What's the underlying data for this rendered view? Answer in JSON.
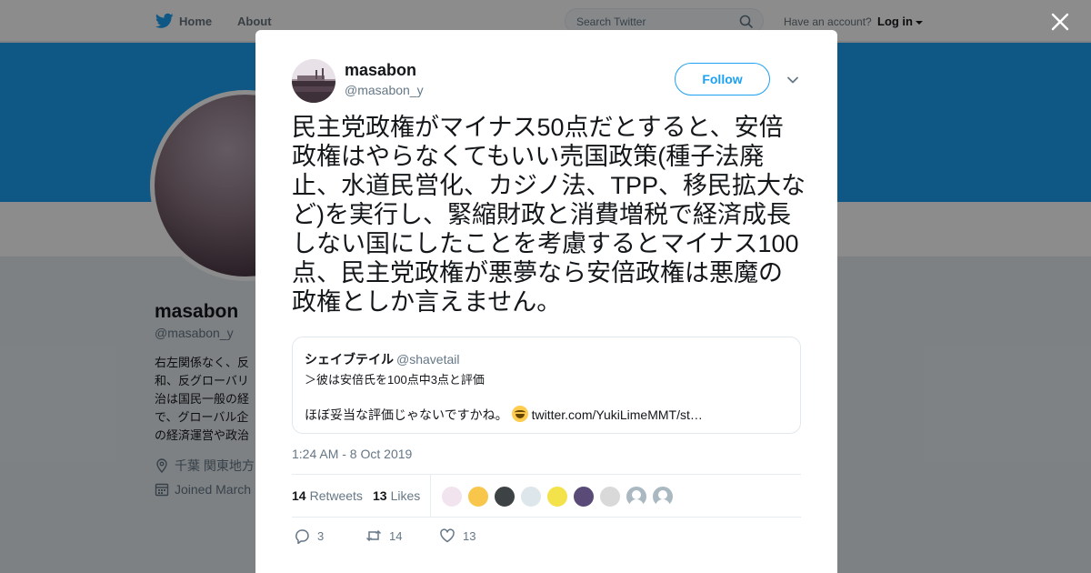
{
  "nav": {
    "home": "Home",
    "about": "About",
    "search_placeholder": "Search Twitter",
    "have_account": "Have an account?",
    "login": "Log in"
  },
  "profile": {
    "name": "masabon",
    "handle": "@masabon_y",
    "bio_lines": [
      "右左関係なく、反",
      "和、反グローバリ",
      "治は国民一般の経",
      "で、グローバル企",
      "の経済運営や政治"
    ],
    "location": "千葉 関東地方",
    "joined": "Joined March"
  },
  "tweet": {
    "author_name": "masabon",
    "author_handle": "@masabon_y",
    "follow_label": "Follow",
    "text": "民主党政権がマイナス50点だとすると、安倍政権はやらなくてもいい売国政策(種子法廃止、水道民営化、カジノ法、TPP、移民拡大など)を実行し、緊縮財政と消費増税で経済成長しない国にしたことを考慮するとマイナス100点、民主党政権が悪夢なら安倍政権は悪魔の政権としか言えません。",
    "quote": {
      "name": "シェイブテイル",
      "handle": "@shavetail",
      "line1": "＞彼は安倍氏を100点中3点と評価",
      "line2_text": "ほぼ妥当な評価じゃないですかね。",
      "line2_link": "twitter.com/YukiLimeMMT/st…"
    },
    "timestamp": "1:24 AM - 8 Oct 2019",
    "retweets_count": "14",
    "retweets_label": "Retweets",
    "likes_count": "13",
    "likes_label": "Likes",
    "actions": {
      "reply_count": "3",
      "retweet_count": "14",
      "like_count": "13"
    }
  },
  "likers": [
    {
      "color": "#f2e4ee"
    },
    {
      "color": "#f7c64a"
    },
    {
      "color": "#3d4245"
    },
    {
      "color": "#dde6ea"
    },
    {
      "color": "#f4e24a"
    },
    {
      "color": "#5a4a78"
    },
    {
      "color": "#d9d9d9"
    },
    {
      "color": "#aab8c2"
    },
    {
      "color": "#aab8c2"
    }
  ],
  "colors": {
    "accent": "#1da1f2",
    "text": "#14171a",
    "muted": "#657786"
  }
}
